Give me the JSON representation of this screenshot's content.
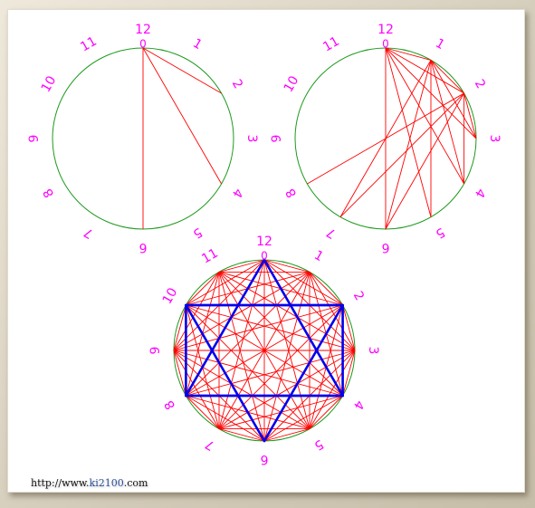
{
  "diagrams": [
    {
      "id": "left-wheel",
      "labels": [
        "12",
        "1",
        "2",
        "3",
        "4",
        "5",
        "6",
        "7",
        "8",
        "9",
        "10",
        "11"
      ],
      "zero_label": "0",
      "chords": [
        [
          0,
          2
        ],
        [
          0,
          4
        ],
        [
          0,
          6
        ]
      ],
      "star": []
    },
    {
      "id": "right-wheel",
      "labels": [
        "12",
        "1",
        "2",
        "3",
        "4",
        "5",
        "6",
        "7",
        "8",
        "9",
        "10",
        "11"
      ],
      "zero_label": "0",
      "chords": [
        [
          0,
          1
        ],
        [
          0,
          2
        ],
        [
          0,
          3
        ],
        [
          0,
          4
        ],
        [
          0,
          5
        ],
        [
          0,
          6
        ],
        [
          1,
          2
        ],
        [
          1,
          3
        ],
        [
          1,
          4
        ],
        [
          1,
          5
        ],
        [
          1,
          6
        ],
        [
          1,
          7
        ],
        [
          2,
          3
        ],
        [
          2,
          4
        ],
        [
          2,
          6
        ],
        [
          2,
          7
        ],
        [
          2,
          8
        ]
      ],
      "star": []
    },
    {
      "id": "center-wheel",
      "labels": [
        "12",
        "1",
        "2",
        "3",
        "4",
        "5",
        "6",
        "7",
        "8",
        "9",
        "10",
        "11"
      ],
      "zero_label": "0",
      "chords": "all-pairs",
      "star": [
        [
          [
            0,
            4
          ],
          [
            4,
            8
          ],
          [
            8,
            0
          ]
        ],
        [
          [
            2,
            6
          ],
          [
            6,
            10
          ],
          [
            10,
            2
          ]
        ],
        [
          [
            2,
            4
          ],
          [
            4,
            8
          ],
          [
            8,
            10
          ],
          [
            10,
            2
          ]
        ]
      ]
    }
  ],
  "colors": {
    "circle": "#1e9a1e",
    "chord": "#ff0000",
    "star": "#0000ee",
    "label": "#ff00ff"
  },
  "watermark": {
    "prefix": "http://www.",
    "highlight": "ki2100",
    "suffix": ".com"
  }
}
